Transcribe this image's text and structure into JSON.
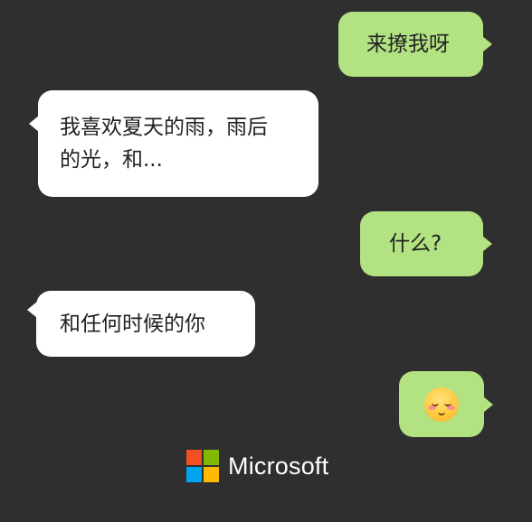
{
  "messages": [
    {
      "id": "msg1",
      "side": "sent",
      "text": "来撩我呀"
    },
    {
      "id": "msg2",
      "side": "received",
      "lines": [
        "我喜欢夏天的雨，雨后",
        "的光，和..."
      ]
    },
    {
      "id": "msg3",
      "side": "sent",
      "text": "什么?"
    },
    {
      "id": "msg4",
      "side": "received",
      "text": "和任何时候的你"
    },
    {
      "id": "msg5",
      "side": "sent",
      "emoji": "blushing-smile-emoji"
    }
  ],
  "brand": {
    "name": "Microsoft",
    "logo_colors": [
      "#f25022",
      "#7fba00",
      "#00a4ef",
      "#ffb900"
    ]
  },
  "colors": {
    "background": "#2f2f2f",
    "sent_bubble": "#b2e281",
    "received_bubble": "#ffffff",
    "message_text": "#222222"
  }
}
